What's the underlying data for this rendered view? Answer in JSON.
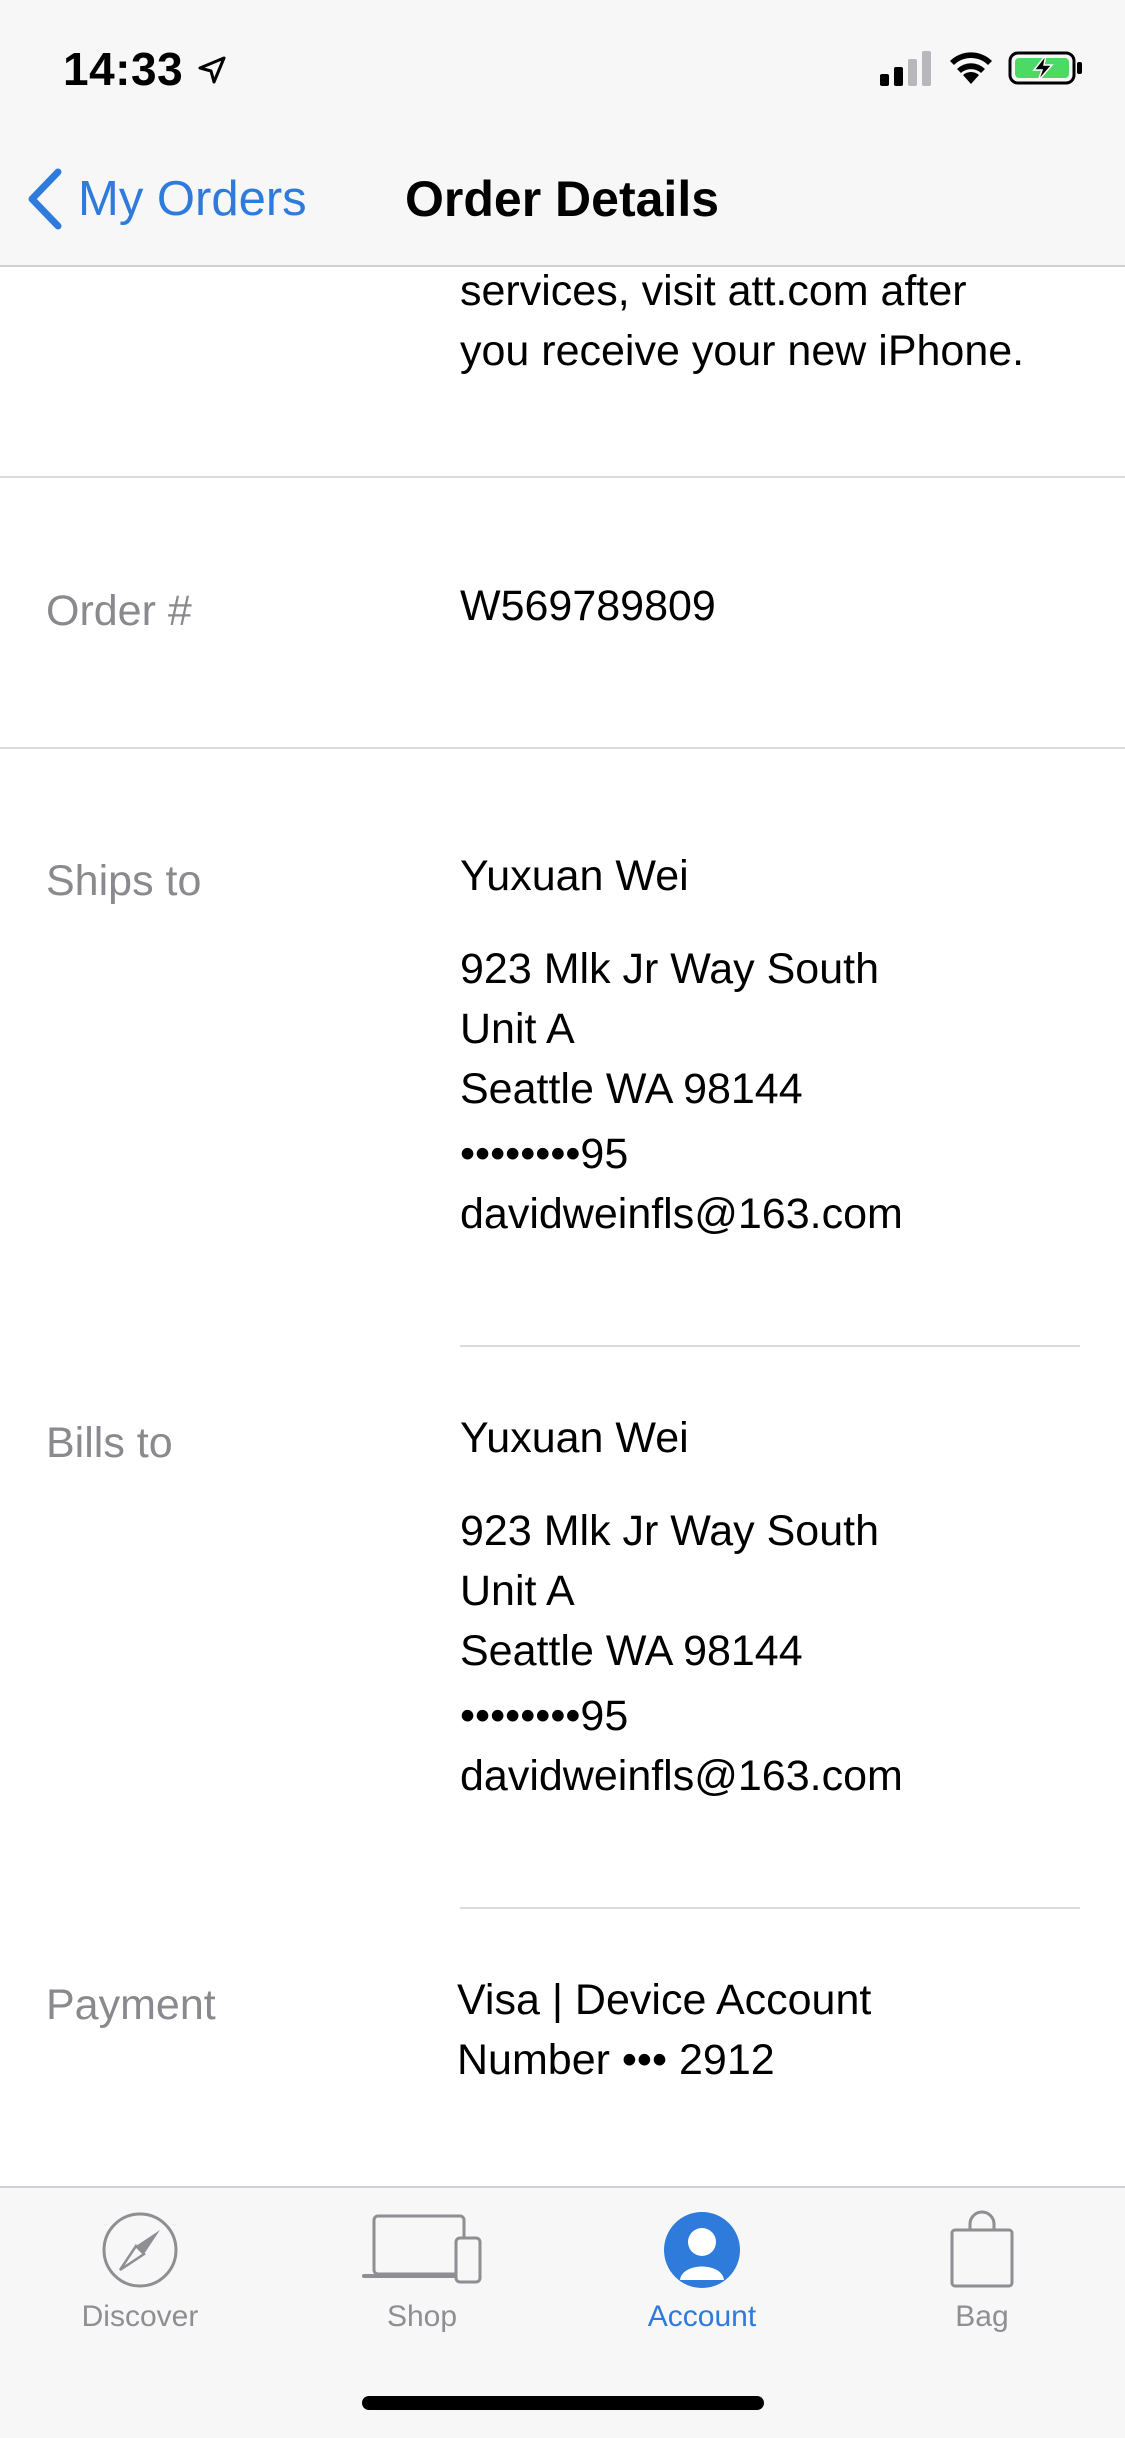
{
  "status_bar": {
    "time": "14:33",
    "icons": [
      "location-arrow-icon",
      "cellular-signal-icon",
      "wifi-icon",
      "battery-charging-icon"
    ],
    "battery_color": "#4cd964"
  },
  "nav": {
    "back_label": "My Orders",
    "title": "Order Details",
    "accent_color": "#2f7bdc"
  },
  "content": {
    "top_text_line1": "services, visit att.com after",
    "top_text_line2": "you receive your new iPhone.",
    "order": {
      "label": "Order #",
      "value": "W569789809"
    },
    "ships_to": {
      "label": "Ships to",
      "name": "Yuxuan Wei",
      "address_line1": "923 Mlk Jr Way South",
      "address_line2": "Unit A",
      "address_line3": "Seattle WA 98144",
      "phone": "••••••••95",
      "email": "davidweinfls@163.com"
    },
    "bills_to": {
      "label": "Bills to",
      "name": "Yuxuan Wei",
      "address_line1": "923 Mlk Jr Way South",
      "address_line2": "Unit A",
      "address_line3": "Seattle WA 98144",
      "phone": "••••••••95",
      "email": "davidweinfls@163.com"
    },
    "payment": {
      "label": "Payment",
      "line1": "Visa | Device Account",
      "line2": "Number ••• 2912"
    }
  },
  "tab_bar": {
    "tabs": [
      {
        "label": "Discover",
        "icon": "compass-icon",
        "active": false
      },
      {
        "label": "Shop",
        "icon": "devices-icon",
        "active": false
      },
      {
        "label": "Account",
        "icon": "account-icon",
        "active": true
      },
      {
        "label": "Bag",
        "icon": "bag-icon",
        "active": false
      }
    ]
  }
}
